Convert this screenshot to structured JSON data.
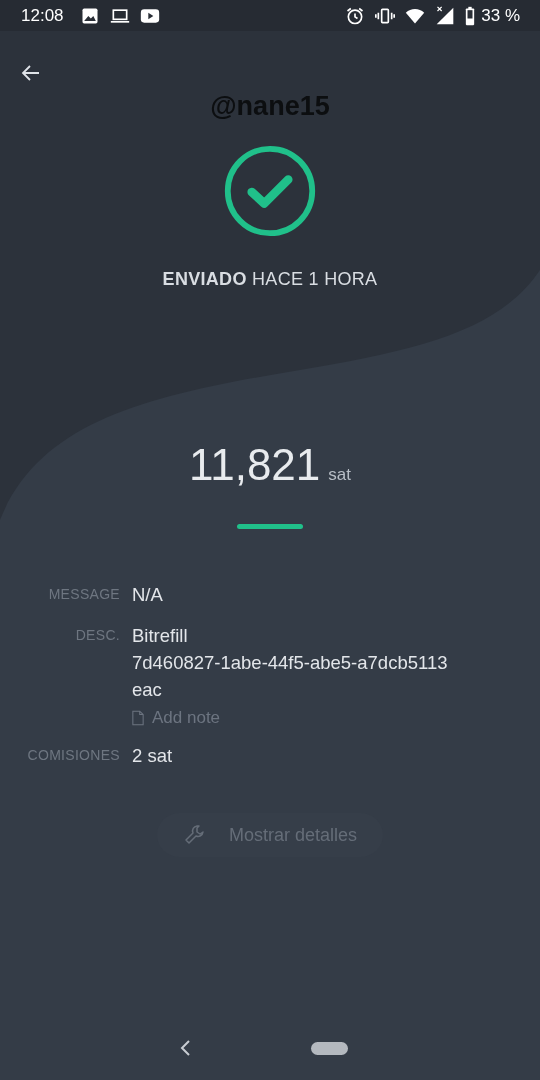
{
  "status_bar": {
    "time": "12:08",
    "battery_text": "33 %"
  },
  "caption": "@nane15",
  "result": {
    "succeeded": true,
    "text": "**ENVIADO** HACE 1 HORA"
  },
  "amount": {
    "value": "11,821",
    "unit": "sat"
  },
  "details": [
    {
      "kind": "text",
      "label": "MESSAGE",
      "lines": [
        "N/A"
      ]
    },
    {
      "kind": "text",
      "label": "DESC.",
      "lines": [
        "Bitrefill",
        "7d460827-1abe-44f5-abe5-a7dcb5113",
        "eac"
      ],
      "note_action": "Add note"
    },
    {
      "kind": "text",
      "label": "COMISIONES",
      "lines": [
        "2 sat"
      ]
    }
  ],
  "details_button": {
    "label": "Mostrar detalles",
    "disabled": true
  }
}
